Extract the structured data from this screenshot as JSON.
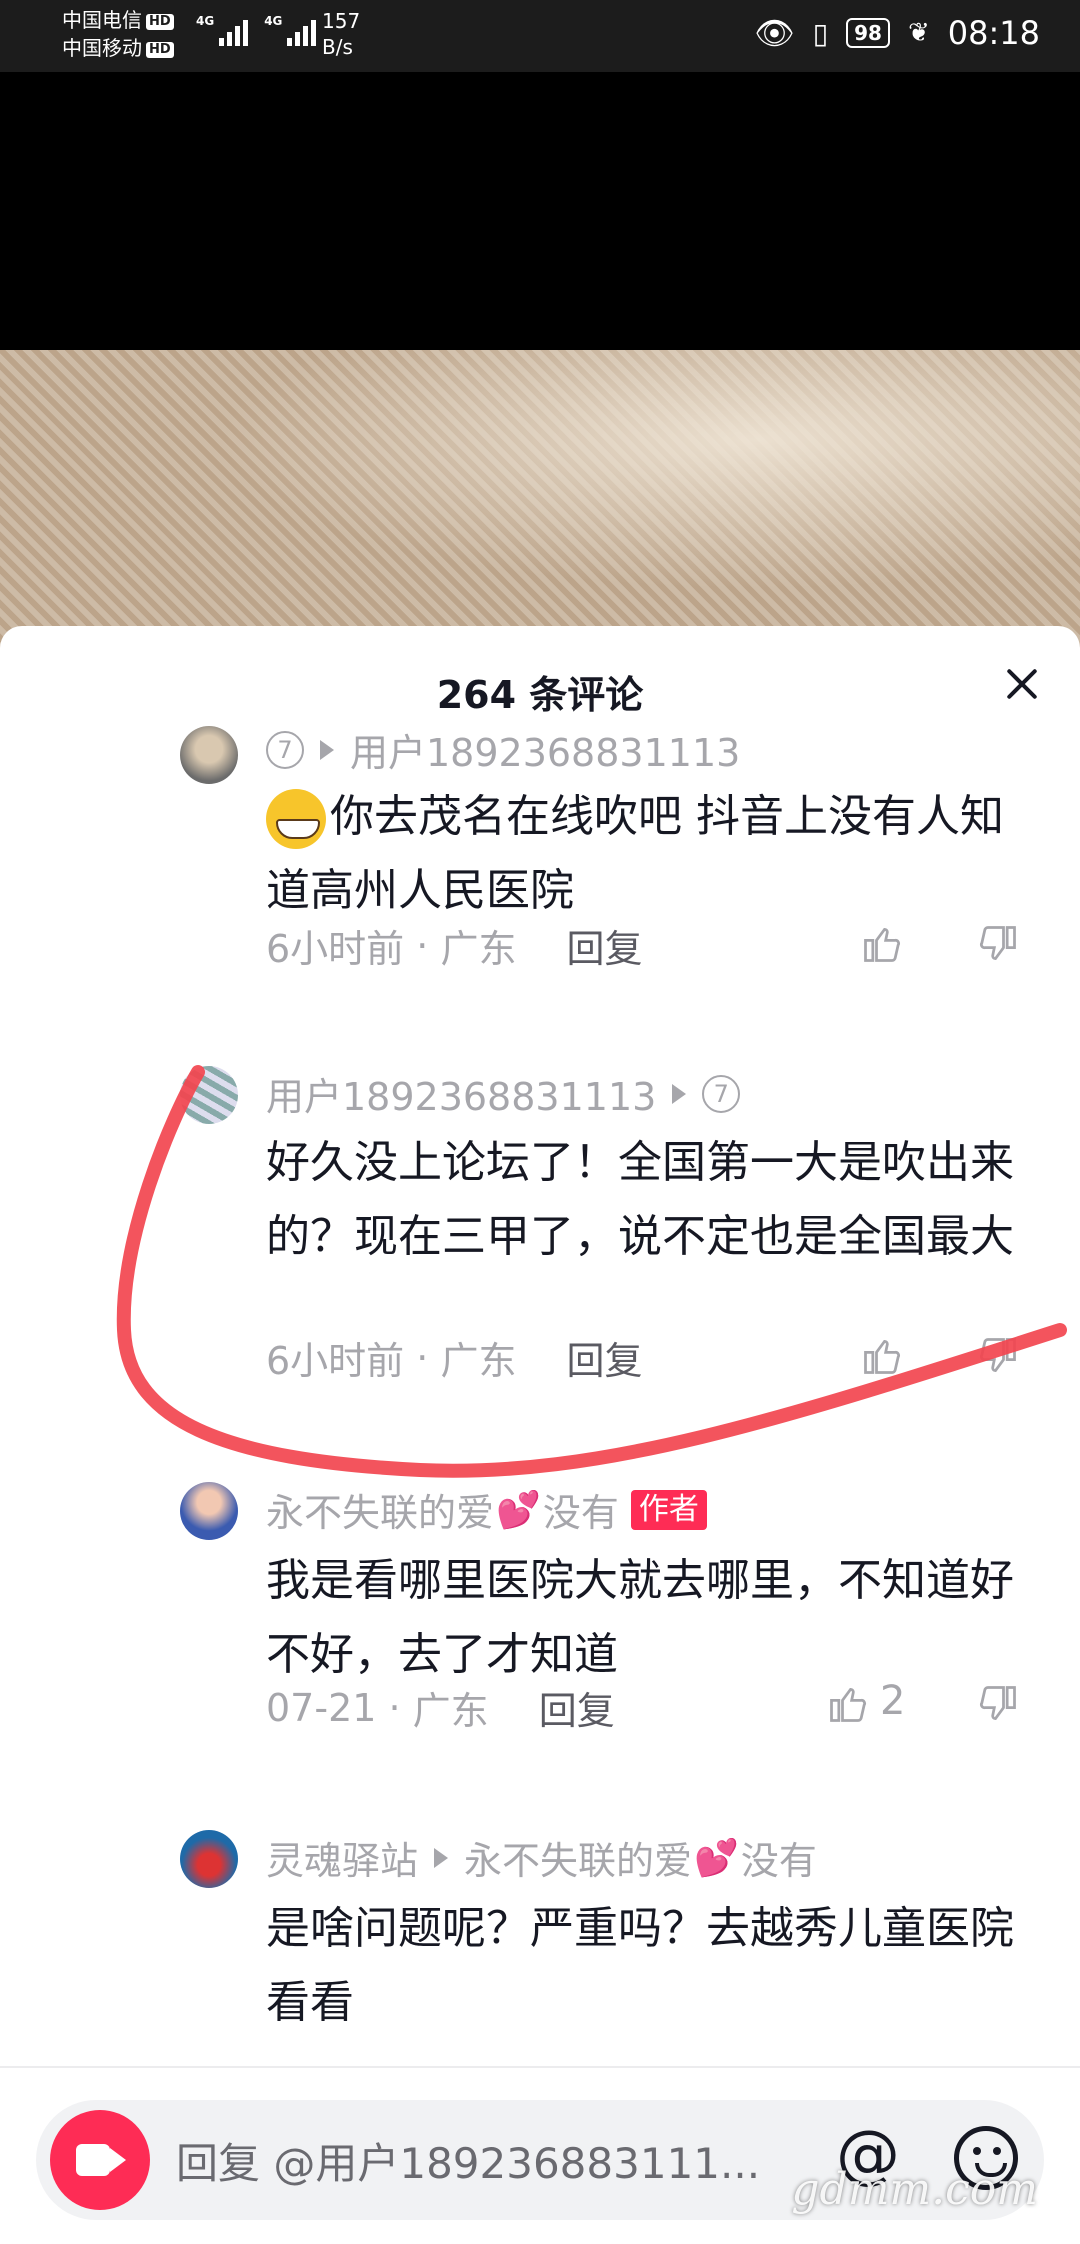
{
  "status_bar": {
    "carrier1": "中国电信",
    "carrier2": "中国移动",
    "hd": "HD",
    "net1": "4G",
    "net2": "4G",
    "speed_value": "157",
    "speed_unit": "B/s",
    "battery": "98",
    "time": "08:18"
  },
  "sheet": {
    "title": "264 条评论"
  },
  "comments": [
    {
      "reply_count": "⑦",
      "user": "用户1892368831113",
      "text_part1": "你去茂名在线吹吧   抖音上没有人知道高州人民医院",
      "time": "6小时前",
      "location": "广东",
      "reply": "回复"
    },
    {
      "user": "用户1892368831113",
      "reply_count": "⑦",
      "text": "好久没上论坛了！全国第一大是吹出来的？现在三甲了，说不定也是全国最大",
      "time": "6小时前",
      "location": "广东",
      "reply": "回复"
    },
    {
      "user": "永不失联的爱",
      "user_suffix": "没有",
      "author_tag": "作者",
      "text": "我是看哪里医院大就去哪里，不知道好不好，去了才知道",
      "time": "07-21",
      "location": "广东",
      "reply": "回复",
      "likes": "2"
    },
    {
      "user": "灵魂驿站",
      "reply_to": "永不失联的爱",
      "reply_to_suffix": "没有",
      "text": "是啥问题呢？严重吗？去越秀儿童医院看看"
    }
  ],
  "input_bar": {
    "placeholder": "回复 @用户189236883111..."
  },
  "watermark": "gdmm.com",
  "colors": {
    "accent": "#fe2c55",
    "annotation": "#f2454f"
  }
}
